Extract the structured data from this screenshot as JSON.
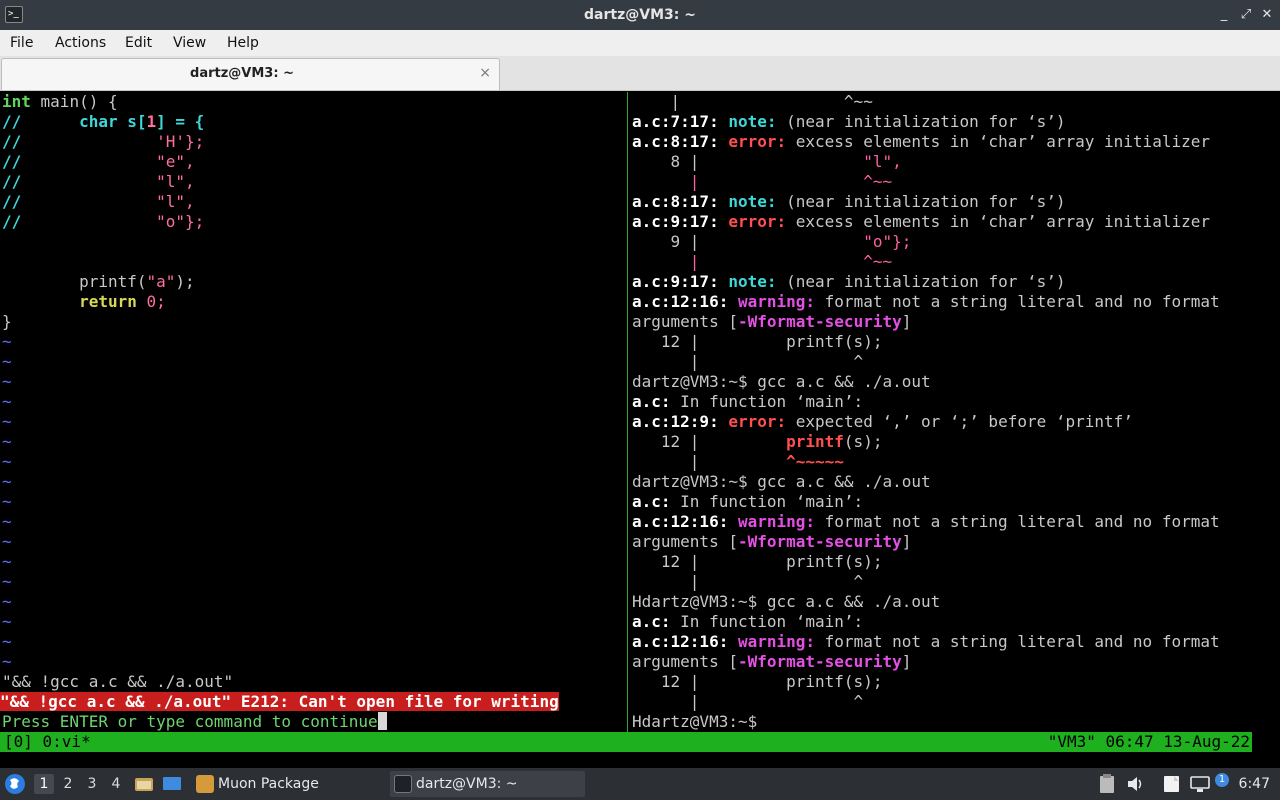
{
  "window": {
    "title": "dartz@VM3: ~",
    "controls": {
      "minimize": "_",
      "maximize": "⤢",
      "close": "✕"
    }
  },
  "menu": [
    "File",
    "Actions",
    "Edit",
    "View",
    "Help"
  ],
  "tab": {
    "label": "dartz@VM3: ~",
    "close": "×"
  },
  "editor": {
    "line_main": "int main() {",
    "line_char": "char s[1] = {",
    "c1": "'H'};",
    "c2": "\"e\",",
    "c3": "\"l\",",
    "c4": "\"l\",",
    "c5": "\"o\"};",
    "comment": "//",
    "printf": "printf(\"a\");",
    "ret_kw": "return",
    "ret_val": "0;",
    "close_brace": "}",
    "tilde": "~",
    "cmdline": "\"&& !gcc a.c && ./a.out\"",
    "error_msg": "\"&& !gcc a.c && ./a.out\" E212: Can't open file for writing",
    "prompt_msg": "Press ENTER or type command to continue"
  },
  "output": {
    "r0": "    |                 ^~~",
    "r1_loc": "a.c:7:17:",
    "r1_kind": "note:",
    "r1_msg": " (near initialization for ‘s’)",
    "r2_loc": "a.c:8:17:",
    "r2_kind": "error:",
    "r2_msg": " excess elements in ‘char’ array initializer",
    "r3_a": "    8 |",
    "r3_b": "                 \"l\",",
    "r4": "      |                 ^~~",
    "r5_loc": "a.c:8:17:",
    "r5_kind": "note:",
    "r5_msg": " (near initialization for ‘s’)",
    "r6_loc": "a.c:9:17:",
    "r6_kind": "error:",
    "r6_msg": " excess elements in ‘char’ array initializer",
    "r7_a": "    9 |",
    "r7_b": "                 \"o\"};",
    "r8": "      |                 ^~~",
    "r9_loc": "a.c:9:17:",
    "r9_kind": "note:",
    "r9_msg": " (near initialization for ‘s’)",
    "r10_loc": "a.c:12:16:",
    "r10_kind": "warning:",
    "r10_msg": " format not a string literal and no format",
    "r11_a": "arguments [",
    "r11_b": "-Wformat-security",
    "r11_c": "]",
    "r12": "   12 |         printf(s);",
    "r13": "      |                ^",
    "r14": "dartz@VM3:~$ gcc a.c && ./a.out",
    "r15_a": "a.c:",
    "r15_b": " In function ‘main’:",
    "r16_loc": "a.c:12:9:",
    "r16_kind": "error:",
    "r16_msg": " expected ‘,’ or ‘;’ before ‘printf’",
    "r17_a": "   12 |         ",
    "r17_b": "printf",
    "r17_c": "(s);",
    "r18_a": "      |         ",
    "r18_b": "^~~~~~",
    "r19": "dartz@VM3:~$ gcc a.c && ./a.out",
    "r20_a": "a.c:",
    "r20_b": " In function ‘main’:",
    "r21_loc": "a.c:12:16:",
    "r21_kind": "warning:",
    "r21_msg": " format not a string literal and no format",
    "r22_a": "arguments [",
    "r22_b": "-Wformat-security",
    "r22_c": "]",
    "r23": "   12 |         printf(s);",
    "r24": "      |                ^",
    "r25": "Hdartz@VM3:~$ gcc a.c && ./a.out",
    "r26_a": "a.c:",
    "r26_b": " In function ‘main’:",
    "r27_loc": "a.c:12:16:",
    "r27_kind": "warning:",
    "r27_msg": " format not a string literal and no format",
    "r28_a": "arguments [",
    "r28_b": "-Wformat-security",
    "r28_c": "]",
    "r29": "   12 |         printf(s);",
    "r30": "      |                ^",
    "r31": "Hdartz@VM3:~$ "
  },
  "tmux": {
    "left": "[0] 0:vi*",
    "right": "\"VM3\" 06:47 13-Aug-22"
  },
  "taskbar": {
    "workspaces": [
      "1",
      "2",
      "3",
      "4"
    ],
    "apps": [
      "Muon Package Manager",
      "dartz@VM3: ~"
    ],
    "clock": "6:47",
    "notif_count": "1"
  }
}
